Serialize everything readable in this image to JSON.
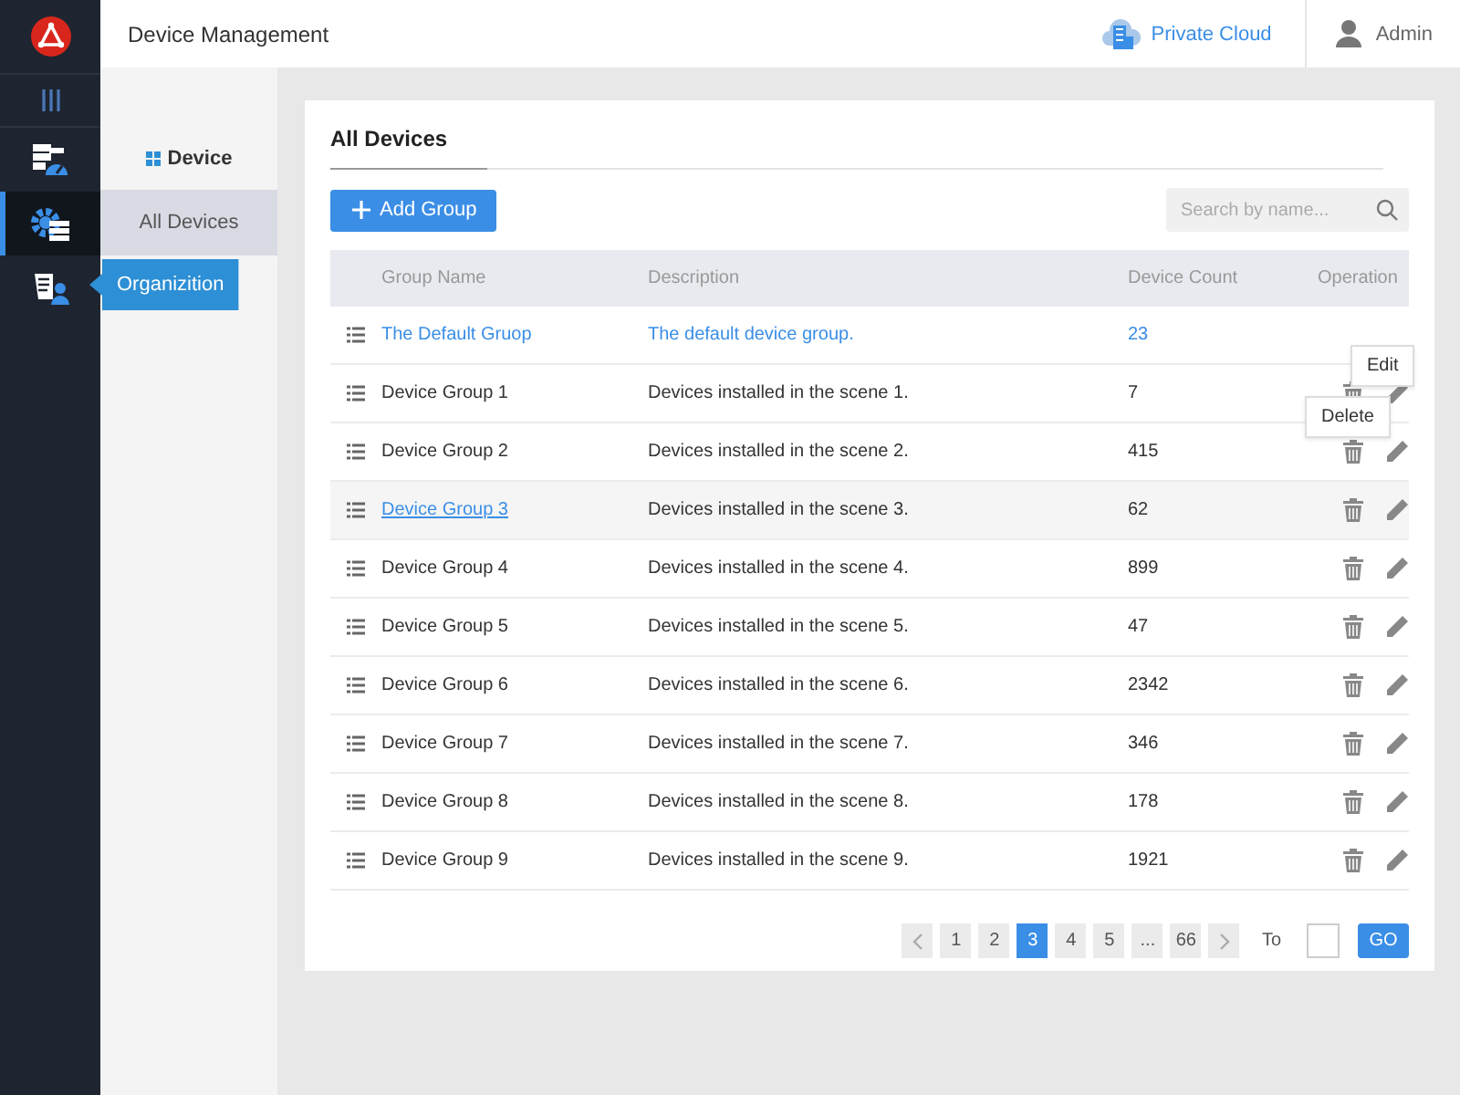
{
  "header": {
    "title": "Device Management",
    "cloud": "Private Cloud",
    "user": "Admin"
  },
  "rail": {
    "items": [
      {
        "kind": "dashboard",
        "selected": false
      },
      {
        "kind": "device",
        "selected": true
      },
      {
        "kind": "organization",
        "selected": false,
        "tooltip": "Organizition"
      }
    ]
  },
  "subnav": {
    "heading": "Device",
    "items": [
      {
        "label": "All Devices",
        "selected": true
      }
    ]
  },
  "card": {
    "title": "All Devices",
    "add_button": "Add Group",
    "search": {
      "placeholder": "Search by name..."
    },
    "columns": [
      "Group Name",
      "Description",
      "Device Count",
      "Operation"
    ],
    "rows": [
      {
        "kind": "default",
        "name": "The Default Gruop",
        "description": "The default device group.",
        "count": "23",
        "hovered": false
      },
      {
        "kind": "group",
        "name": "Device Group 1",
        "description": "Devices installed in the scene 1.",
        "count": "7",
        "hovered": false,
        "tooltip": "Edit"
      },
      {
        "kind": "group",
        "name": "Device Group 2",
        "description": "Devices installed in the scene 2.",
        "count": "415",
        "hovered": false,
        "tooltip": "Delete"
      },
      {
        "kind": "group",
        "name": "Device Group 3",
        "description": "Devices installed in the scene 3.",
        "count": "62",
        "hovered": true
      },
      {
        "kind": "group",
        "name": "Device Group 4",
        "description": "Devices installed in the scene 4.",
        "count": "899",
        "hovered": false
      },
      {
        "kind": "group",
        "name": "Device Group 5",
        "description": "Devices installed in the scene 5.",
        "count": "47",
        "hovered": false
      },
      {
        "kind": "group",
        "name": "Device Group 6",
        "description": "Devices installed in the scene 6.",
        "count": "2342",
        "hovered": false
      },
      {
        "kind": "group",
        "name": "Device Group 7",
        "description": "Devices installed in the scene 7.",
        "count": "346",
        "hovered": false
      },
      {
        "kind": "group",
        "name": "Device Group 8",
        "description": "Devices installed in the scene 8.",
        "count": "178",
        "hovered": false
      },
      {
        "kind": "group",
        "name": "Device Group 9",
        "description": "Devices installed in the scene 9.",
        "count": "1921",
        "hovered": false
      }
    ],
    "pagination": {
      "pages": [
        {
          "kind": "prev",
          "selected": false
        },
        {
          "kind": "page",
          "label": "1",
          "selected": false
        },
        {
          "kind": "page",
          "label": "2",
          "selected": false
        },
        {
          "kind": "page",
          "label": "3",
          "selected": true
        },
        {
          "kind": "page",
          "label": "4",
          "selected": false
        },
        {
          "kind": "page",
          "label": "5",
          "selected": false
        },
        {
          "kind": "ellipsis",
          "label": "...",
          "selected": false
        },
        {
          "kind": "page",
          "label": "66",
          "selected": false
        },
        {
          "kind": "next",
          "selected": false
        }
      ],
      "goto_label": "To",
      "go_button": "GO"
    }
  }
}
